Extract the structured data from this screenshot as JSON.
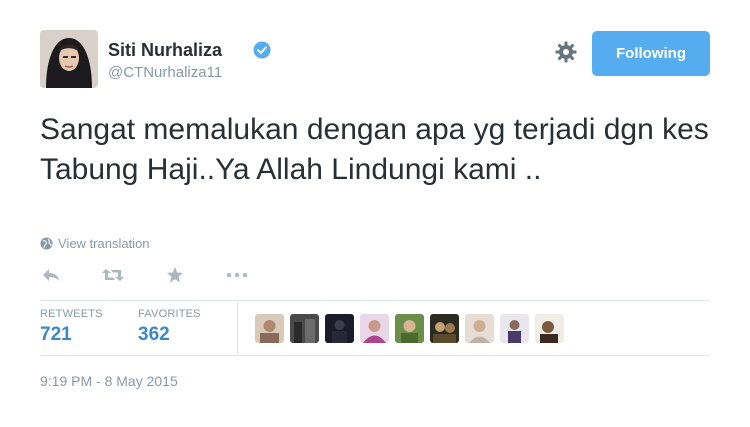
{
  "user": {
    "display_name": "Siti Nurhaliza",
    "handle": "@CTNurhaliza11",
    "verified": true
  },
  "follow_button": {
    "label": "Following"
  },
  "tweet": {
    "text": "Sangat memalukan dengan apa yg terjadi dgn kes Tabung Haji..Ya Allah Lindungi kami .."
  },
  "translate": {
    "label": "View translation",
    "icon": "globe-icon"
  },
  "actions": [
    "reply-icon",
    "retweet-icon",
    "favorite-icon",
    "more-icon"
  ],
  "stats": {
    "retweets_label": "RETWEETS",
    "retweets_value": "721",
    "favorites_label": "FAVORITES",
    "favorites_value": "362"
  },
  "timestamp": "9:19 PM - 8 May 2015",
  "colors": {
    "accent": "#55acee",
    "stat_value": "#3b88c3",
    "muted": "#8899a6",
    "text": "#292f33"
  }
}
